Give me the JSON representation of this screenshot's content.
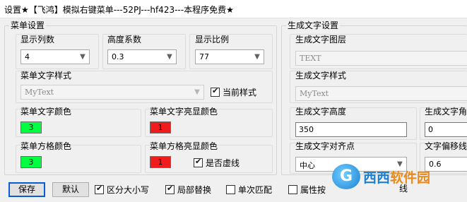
{
  "window": {
    "title": "设置★【飞鸿】模拟右键菜单---52PJ---hf423---本程序免费★"
  },
  "menu_settings": {
    "title": "菜单设置",
    "columns": {
      "label": "显示列数",
      "value": "4"
    },
    "height_factor": {
      "label": "高度系数",
      "value": "0.3"
    },
    "display_ratio": {
      "label": "显示比例",
      "value": "77"
    },
    "text_style": {
      "label": "菜单文字样式",
      "value": "MyText",
      "checkbox_label": "当前样式"
    },
    "text_color": {
      "label": "菜单文字颜色",
      "value": "3",
      "color": "#00ff40"
    },
    "highlight_color": {
      "label": "菜单文字亮显颜色",
      "value": "1",
      "color": "#ee1c1c"
    },
    "cell_color": {
      "label": "菜单方格颜色",
      "value": "3",
      "color": "#00ff40"
    },
    "cell_highlight_color": {
      "label": "菜单方格亮显颜色",
      "value": "1",
      "color": "#ee1c1c",
      "checkbox_label": "是否虚线"
    }
  },
  "text_settings": {
    "title": "生成文字设置",
    "layer": {
      "label": "生成文字图层",
      "value": "TEXT"
    },
    "style": {
      "label": "生成文字样式",
      "value": "MyText"
    },
    "height": {
      "label": "生成文字高度",
      "value": "350"
    },
    "angle": {
      "label": "生成文字角",
      "value": "0"
    },
    "align": {
      "label": "生成文字对齐点",
      "value": "中心"
    },
    "offset": {
      "label": "文字偏移线",
      "value": "0.6"
    }
  },
  "footer": {
    "save": "保存",
    "default": "默认",
    "case_sensitive": "区分大小写",
    "partial_replace": "局部替换",
    "single_match": "单次匹配",
    "attr_prefix": "属性按",
    "attr_suffix": "线"
  },
  "watermark": {
    "logo": "G",
    "text_main": "西西",
    "text_sub": "软件园"
  }
}
